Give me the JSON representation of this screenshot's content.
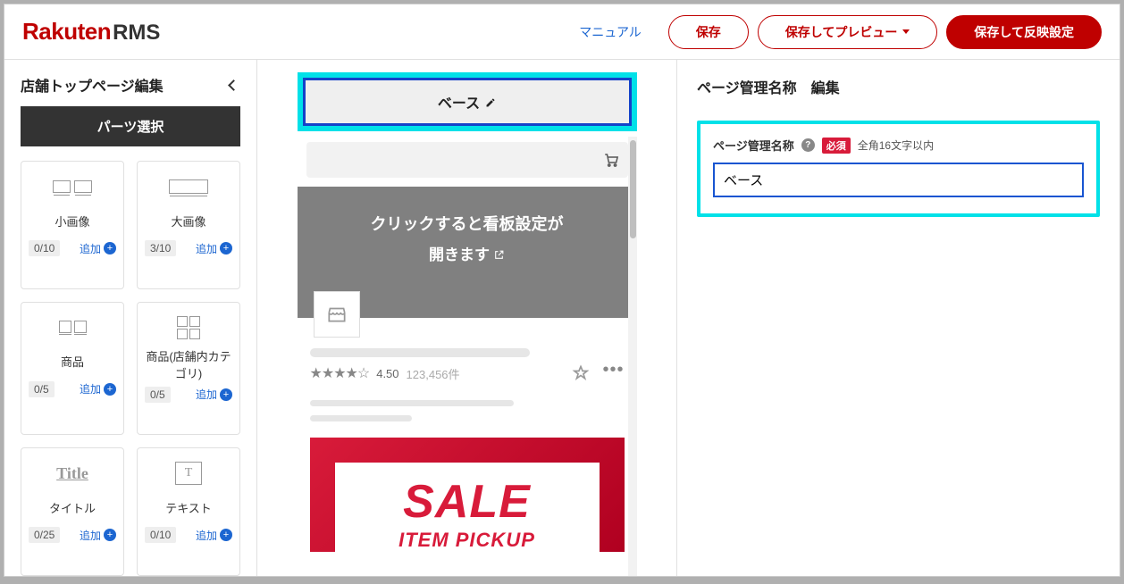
{
  "header": {
    "logo_main": "Rakuten",
    "logo_sub": "RMS",
    "manual_link": "マニュアル",
    "save_btn": "保存",
    "preview_btn": "保存してプレビュー",
    "apply_btn": "保存して反映設定"
  },
  "sidebar": {
    "title": "店舗トップページ編集",
    "parts_select": "パーツ選択",
    "add_label": "追加",
    "parts": [
      {
        "label": "小画像",
        "count": "0/10"
      },
      {
        "label": "大画像",
        "count": "3/10"
      },
      {
        "label": "商品",
        "count": "0/5"
      },
      {
        "label": "商品(店舗内カテゴリ)",
        "count": "0/5"
      },
      {
        "label": "タイトル",
        "count": "0/25",
        "icon_text": "Title"
      },
      {
        "label": "テキスト",
        "count": "0/10"
      }
    ]
  },
  "center": {
    "base_button": "ベース",
    "banner_line1": "クリックすると看板設定が",
    "banner_line2": "開きます",
    "rating_value": "4.50",
    "rating_count": "123,456件",
    "sale_big": "SALE",
    "sale_sub": "ITEM PICKUP"
  },
  "right": {
    "title": "ページ管理名称　編集",
    "field_label": "ページ管理名称",
    "required": "必須",
    "hint": "全角16文字以内",
    "input_value": "ベース"
  }
}
